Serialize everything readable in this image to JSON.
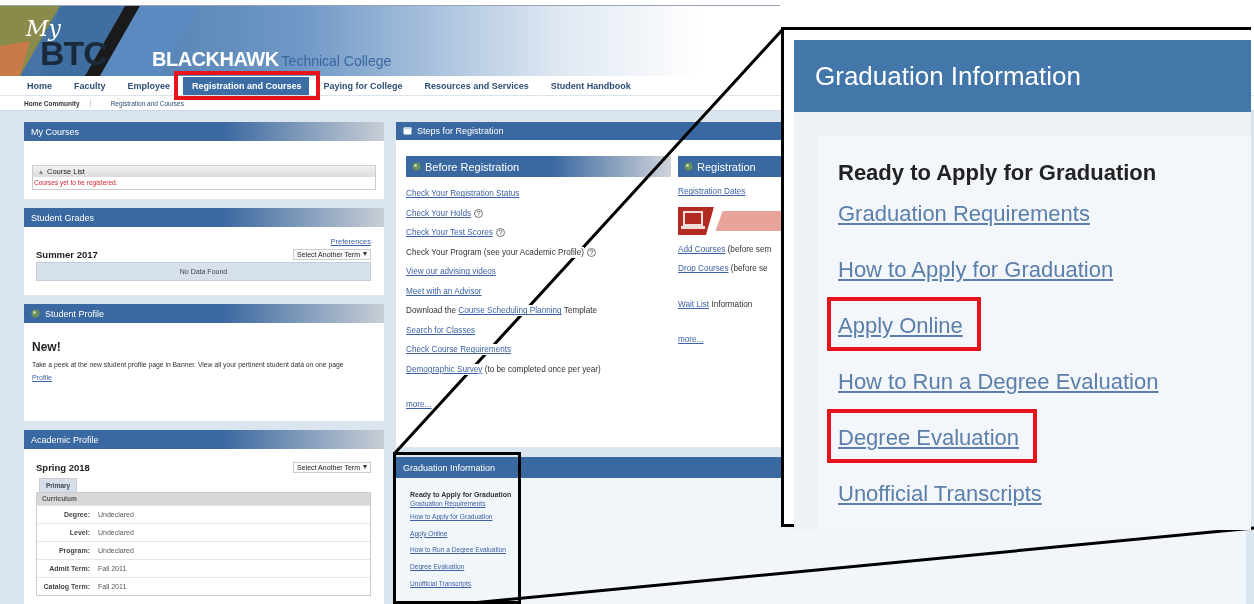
{
  "header": {
    "logo_my": "My",
    "logo_btc": "BTC",
    "college_name": "BLACKHAWK",
    "college_suffix": "Technical College"
  },
  "nav": [
    {
      "label": "Home",
      "selected": false,
      "highlighted": false
    },
    {
      "label": "Faculty",
      "selected": false,
      "highlighted": false
    },
    {
      "label": "Employee",
      "selected": false,
      "highlighted": false
    },
    {
      "label": "Registration and Courses",
      "selected": true,
      "highlighted": true
    },
    {
      "label": "Paying for College",
      "selected": false,
      "highlighted": false
    },
    {
      "label": "Resources and Services",
      "selected": false,
      "highlighted": false
    },
    {
      "label": "Student Handbook",
      "selected": false,
      "highlighted": false
    }
  ],
  "breadcrumb": [
    "Home Community",
    "Registration and Courses"
  ],
  "my_courses": {
    "title": "My Courses",
    "course_list": {
      "title": "Course List",
      "expanded": true,
      "message": "Courses yet to be registered."
    }
  },
  "student_grades": {
    "title": "Student Grades",
    "preferences_link": "Preferences",
    "term": "Summer 2017",
    "term_select": "Select Another Term",
    "empty_message": "No Data Found"
  },
  "student_profile": {
    "title": "Student Profile",
    "heading": "New!",
    "text": "Take a peek at the new student profile page in Banner. View all your pertinent student data on one page",
    "link": "Profile"
  },
  "academic_profile": {
    "title": "Academic Profile",
    "term": "Spring 2018",
    "term_select": "Select Another Term",
    "tabs": [
      {
        "label": "Primary",
        "selected": true
      }
    ],
    "section": "Curriculum",
    "rows": [
      {
        "label": "Degree:",
        "value": "Undeclared"
      },
      {
        "label": "Level:",
        "value": "Undeclared"
      },
      {
        "label": "Program:",
        "value": "Undeclared"
      },
      {
        "label": "Admit Term:",
        "value": "Fall 2011"
      },
      {
        "label": "Catalog Term:",
        "value": "Fall 2011"
      }
    ]
  },
  "steps": {
    "title": "Steps for Registration",
    "columns": [
      {
        "title": "Before Registration",
        "groups": [
          [
            {
              "kind": "text",
              "parts": [
                {
                  "kind": "link",
                  "text": "Check Your Registration Status"
                }
              ]
            },
            {
              "kind": "text",
              "parts": [
                {
                  "kind": "link",
                  "text": "Check Your Holds"
                },
                {
                  "kind": "help"
                }
              ]
            },
            {
              "kind": "text",
              "parts": [
                {
                  "kind": "link",
                  "text": "Check Your Test Scores"
                },
                {
                  "kind": "help"
                }
              ]
            },
            {
              "kind": "text",
              "parts": [
                {
                  "kind": "text",
                  "text": "Check Your Program (see your Academic Profile)"
                },
                {
                  "kind": "help"
                }
              ]
            },
            {
              "kind": "text",
              "parts": [
                {
                  "kind": "link",
                  "text": "View our advising videos"
                }
              ]
            },
            {
              "kind": "text",
              "parts": [
                {
                  "kind": "link",
                  "text": "Meet with an Advisor"
                }
              ]
            },
            {
              "kind": "text",
              "parts": [
                {
                  "kind": "text",
                  "text": "Download the "
                },
                {
                  "kind": "link",
                  "text": "Course Scheduling Planning"
                },
                {
                  "kind": "text",
                  "text": " Template"
                }
              ]
            },
            {
              "kind": "text",
              "parts": [
                {
                  "kind": "link",
                  "text": "Search for Classes"
                }
              ]
            },
            {
              "kind": "text",
              "parts": [
                {
                  "kind": "link",
                  "text": "Check Course Requirements"
                }
              ]
            },
            {
              "kind": "text",
              "parts": [
                {
                  "kind": "link",
                  "text": "Demographic Survey"
                },
                {
                  "kind": "text",
                  "text": " (to be completed once per year)"
                }
              ]
            }
          ],
          [
            {
              "kind": "text",
              "parts": [
                {
                  "kind": "link",
                  "text": "more..."
                }
              ]
            }
          ]
        ]
      },
      {
        "title": "Registration",
        "groups": [
          [
            {
              "kind": "text",
              "parts": [
                {
                  "kind": "link",
                  "text": "Registration Dates"
                }
              ]
            }
          ],
          [
            {
              "kind": "picture"
            }
          ],
          [
            {
              "kind": "text",
              "parts": [
                {
                  "kind": "link",
                  "text": "Add Courses"
                },
                {
                  "kind": "text",
                  "text": " (before sem"
                }
              ]
            },
            {
              "kind": "text",
              "parts": [
                {
                  "kind": "link",
                  "text": "Drop Courses"
                },
                {
                  "kind": "text",
                  "text": " (before se"
                }
              ]
            }
          ],
          [
            {
              "kind": "text",
              "parts": [
                {
                  "kind": "link",
                  "text": "Wait List"
                },
                {
                  "kind": "text",
                  "text": " Information"
                }
              ]
            }
          ],
          [
            {
              "kind": "text",
              "parts": [
                {
                  "kind": "link",
                  "text": "more..."
                }
              ]
            }
          ]
        ]
      }
    ]
  },
  "graduation": {
    "title": "Graduation Information",
    "heading": "Ready to Apply for Graduation",
    "links": [
      "Graduation Requirements",
      "How to Apply for Graduation",
      "Apply Online",
      "How to Run a Degree Evaluation",
      "Degree Evaluation",
      "Unofficial Transcripts"
    ]
  },
  "callout": {
    "title": "Graduation Information",
    "heading": "Ready to Apply for Graduation",
    "links": [
      {
        "label": "Graduation Requirements",
        "highlighted": false
      },
      {
        "label": "How to Apply for Graduation",
        "highlighted": false
      },
      {
        "label": "Apply Online",
        "highlighted": true
      },
      {
        "label": "How to Run a Degree Evaluation",
        "highlighted": false
      },
      {
        "label": "Degree Evaluation",
        "highlighted": true
      },
      {
        "label": "Unofficial Transcripts",
        "highlighted": false
      }
    ]
  }
}
